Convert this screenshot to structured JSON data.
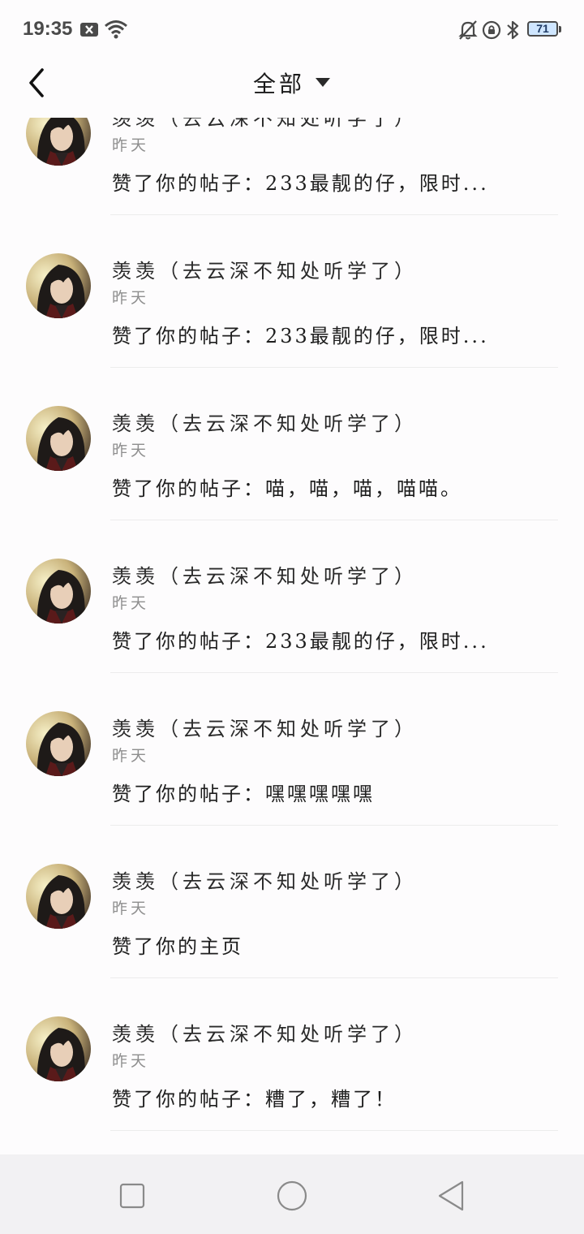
{
  "status_bar": {
    "time": "19:35",
    "icons": [
      "notification-x-icon",
      "wifi-icon",
      "mute-bell-icon",
      "rotation-lock-icon",
      "bluetooth-icon"
    ],
    "battery": "71"
  },
  "header": {
    "title": "全部",
    "back_icon": "chevron-left-icon",
    "dropdown_icon": "caret-down-icon"
  },
  "notifications": [
    {
      "name": "羡羡（去云深不知处听学了）",
      "time": "昨天",
      "text": "赞了你的帖子：233最靓的仔，限时..."
    },
    {
      "name": "羡羡（去云深不知处听学了）",
      "time": "昨天",
      "text": "赞了你的帖子：233最靓的仔，限时..."
    },
    {
      "name": "羡羡（去云深不知处听学了）",
      "time": "昨天",
      "text": "赞了你的帖子：喵，喵，喵，喵喵。"
    },
    {
      "name": "羡羡（去云深不知处听学了）",
      "time": "昨天",
      "text": "赞了你的帖子：233最靓的仔，限时..."
    },
    {
      "name": "羡羡（去云深不知处听学了）",
      "time": "昨天",
      "text": "赞了你的帖子：嘿嘿嘿嘿嘿"
    },
    {
      "name": "羡羡（去云深不知处听学了）",
      "time": "昨天",
      "text": "赞了你的主页"
    },
    {
      "name": "羡羡（去云深不知处听学了）",
      "time": "昨天",
      "text": "赞了你的帖子：糟了，糟了！"
    }
  ],
  "nav_bar": {
    "icons": [
      "recents-square-icon",
      "home-circle-icon",
      "back-triangle-icon"
    ]
  },
  "colors": {
    "background": "#fdfcfd",
    "separator": "#ececec",
    "secondary_text": "#8e8e8e",
    "nav_background": "#f2f1f3"
  }
}
